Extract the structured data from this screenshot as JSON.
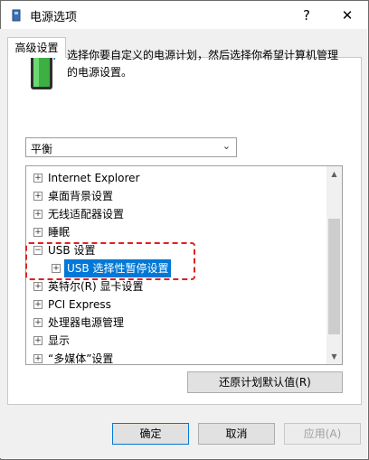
{
  "window": {
    "title": "电源选项",
    "help_label": "?",
    "close_label": "✕"
  },
  "tab": {
    "label": "高级设置"
  },
  "description": "选择你要自定义的电源计划，然后选择你希望计算机管理的电源设置。",
  "plan_select": {
    "value": "平衡"
  },
  "tree": {
    "items": [
      {
        "label": "Internet Explorer",
        "expander": "+"
      },
      {
        "label": "桌面背景设置",
        "expander": "+"
      },
      {
        "label": "无线适配器设置",
        "expander": "+"
      },
      {
        "label": "睡眠",
        "expander": "+"
      },
      {
        "label": "USB 设置",
        "expander": "−"
      },
      {
        "label": "USB 选择性暂停设置",
        "expander": "+"
      },
      {
        "label": "英特尔(R) 显卡设置",
        "expander": "+"
      },
      {
        "label": "PCI Express",
        "expander": "+"
      },
      {
        "label": "处理器电源管理",
        "expander": "+"
      },
      {
        "label": "显示",
        "expander": "+"
      },
      {
        "label": "“多媒体”设置",
        "expander": "+"
      }
    ]
  },
  "buttons": {
    "restore": "还原计划默认值(R)",
    "ok": "确定",
    "cancel": "取消",
    "apply": "应用(A)"
  },
  "colors": {
    "selection": "#0078d7",
    "annotation": "#e02020",
    "battery": "#3cb043"
  }
}
